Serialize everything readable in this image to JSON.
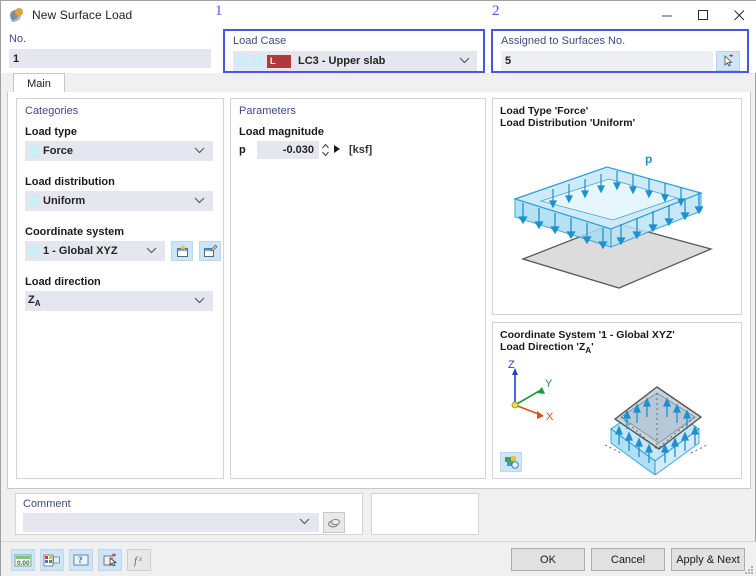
{
  "window": {
    "title": "New Surface Load",
    "icon": "surface-load-icon",
    "minimize": "minimize-icon",
    "maximize": "maximize-icon",
    "close": "close-icon"
  },
  "annotations": [
    {
      "label": "1"
    },
    {
      "label": "2"
    }
  ],
  "top_fields": {
    "no": {
      "label": "No.",
      "value": "1"
    },
    "load_case": {
      "label": "Load Case",
      "value": "LC3 - Upper slab",
      "badge": "L",
      "badge_color": "#b03a3a",
      "caret": "chevron-down-icon"
    },
    "assigned": {
      "label": "Assigned to Surfaces No.",
      "value": "5",
      "pick_button": "pick-surfaces-icon"
    }
  },
  "tabs": [
    {
      "label": "Main",
      "active": true
    }
  ],
  "categories": {
    "heading": "Categories",
    "load_type": {
      "label": "Load type",
      "value": "Force"
    },
    "load_distribution": {
      "label": "Load distribution",
      "value": "Uniform"
    },
    "coordinate_system": {
      "label": "Coordinate system",
      "value": "1 - Global XYZ",
      "new_button": "new-coordinate-system-icon",
      "edit_button": "edit-coordinate-system-icon"
    },
    "load_direction": {
      "label": "Load direction",
      "value_main": "Z",
      "value_sub": "A"
    }
  },
  "parameters": {
    "heading": "Parameters",
    "load_magnitude": {
      "label": "Load magnitude",
      "symbol": "p",
      "value": "-0.030",
      "unit": "[ksf]",
      "spinner": "spinner-icon",
      "formula_arrow": "play-arrow-icon"
    }
  },
  "preview_top": {
    "caption_line1": "Load Type 'Force'",
    "caption_line2": "Load Distribution 'Uniform'",
    "load_label": "p"
  },
  "preview_bottom": {
    "caption_line1": "Coordinate System '1 - Global XYZ'",
    "caption_line2_prefix": "Load Direction 'Z",
    "caption_line2_sub": "A",
    "caption_line2_suffix": "'",
    "axis_z": "Z",
    "axis_y": "Y",
    "axis_x": "X",
    "image_button": "preview-settings-icon"
  },
  "comment": {
    "label": "Comment",
    "value": "",
    "placeholder": "",
    "caret": "chevron-down-icon",
    "button": "comment-library-icon"
  },
  "footer": {
    "tools": [
      {
        "name": "units-decimal-places-icon",
        "style": "blue"
      },
      {
        "name": "display-properties-icon",
        "style": "blue"
      },
      {
        "name": "help-icon",
        "style": "blue"
      },
      {
        "name": "pick-object-icon",
        "style": "blue"
      },
      {
        "name": "formula-icon",
        "style": "gray"
      }
    ],
    "buttons": [
      {
        "label": "OK"
      },
      {
        "label": "Cancel"
      },
      {
        "label": "Apply & Next"
      }
    ]
  },
  "colors": {
    "accent_blue": "#4a56e8",
    "label_blue": "#3f4a8a",
    "input_bg": "#e6e6f0",
    "icon_blue": "#2a9fd6",
    "load_case_red": "#b03a3a"
  }
}
